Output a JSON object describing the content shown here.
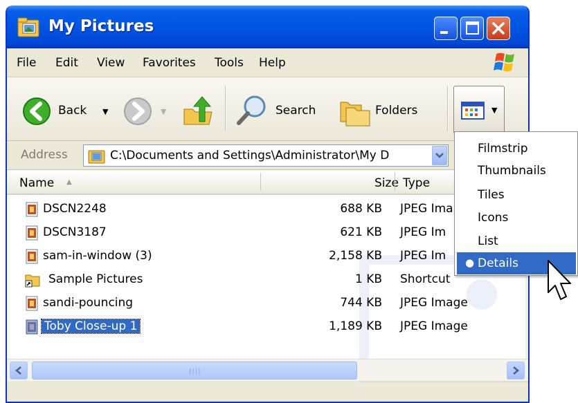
{
  "window": {
    "title": "My Pictures",
    "title_icon": "my-pictures-folder-icon",
    "controls": [
      "minimize",
      "maximize",
      "close"
    ]
  },
  "menu": [
    "File",
    "Edit",
    "View",
    "Favorites",
    "Tools",
    "Help"
  ],
  "toolbar": {
    "back_label": "Back",
    "search_label": "Search",
    "folders_label": "Folders",
    "icons": [
      "back-arrow-icon",
      "forward-arrow-icon",
      "up-folder-icon",
      "search-magnifier-icon",
      "folders-icon",
      "views-icon"
    ]
  },
  "address": {
    "label": "Address",
    "value": "C:\\Documents and Settings\\Administrator\\My D"
  },
  "columns": {
    "name": "Name",
    "size": "Size",
    "type": "Type"
  },
  "files": [
    {
      "name": "DSCN2248",
      "size": "688 KB",
      "type": "JPEG Ima",
      "icon": "jpeg-file-icon"
    },
    {
      "name": "DSCN3187",
      "size": "621 KB",
      "type": "JPEG Im",
      "icon": "jpeg-file-icon"
    },
    {
      "name": "sam-in-window (3)",
      "size": "2,158 KB",
      "type": "JPEG Im",
      "icon": "jpeg-file-icon"
    },
    {
      "name": "Sample Pictures",
      "size": "1 KB",
      "type": "Shortcut",
      "icon": "shortcut-folder-icon"
    },
    {
      "name": "sandi-pouncing",
      "size": "744 KB",
      "type": "JPEG Image",
      "icon": "jpeg-file-icon"
    },
    {
      "name": "Toby Close-up 1",
      "size": "1,189 KB",
      "type": "JPEG Image",
      "icon": "jpeg-file-icon",
      "selected": true
    }
  ],
  "views_menu": {
    "items": [
      "Filmstrip",
      "Thumbnails",
      "Tiles",
      "Icons",
      "List",
      "Details"
    ],
    "active": "Details"
  },
  "colors": {
    "titlebar": "#0054e3",
    "selection": "#316ac5",
    "chrome": "#ece9d8"
  }
}
